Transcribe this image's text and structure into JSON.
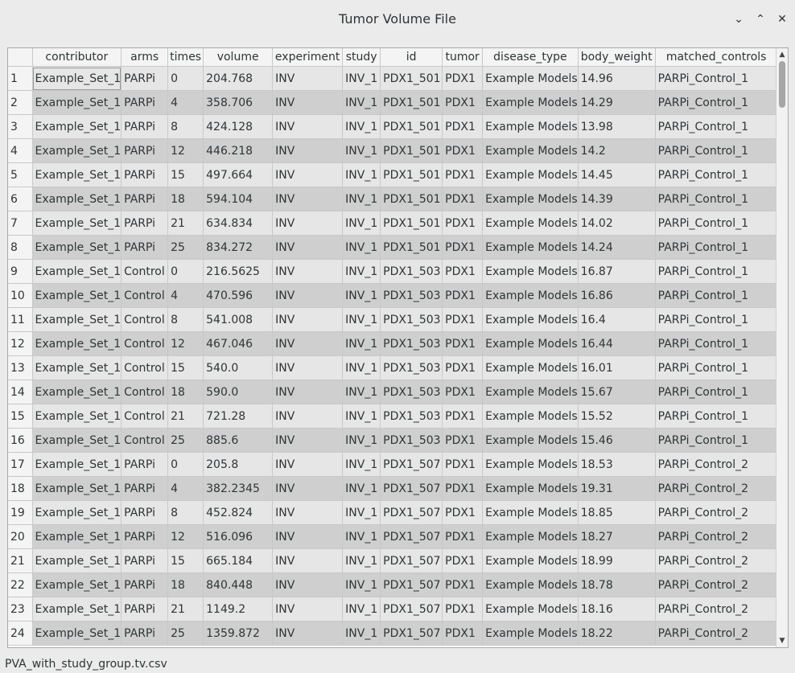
{
  "window": {
    "title": "Tumor Volume File",
    "buttons": {
      "minimize": "⌄",
      "maximize": "⌃",
      "close": "✕"
    }
  },
  "table": {
    "columns": [
      "",
      "contributor",
      "arms",
      "times",
      "volume",
      "experiment",
      "study",
      "id",
      "tumor",
      "disease_type",
      "body_weight",
      "matched_controls"
    ],
    "rows": [
      [
        "1",
        "Example_Set_1",
        "PARPi",
        "0",
        "204.768",
        "INV",
        "INV_1",
        "PDX1_501",
        "PDX1",
        "Example Models",
        "14.96",
        "PARPi_Control_1"
      ],
      [
        "2",
        "Example_Set_1",
        "PARPi",
        "4",
        "358.706",
        "INV",
        "INV_1",
        "PDX1_501",
        "PDX1",
        "Example Models",
        "14.29",
        "PARPi_Control_1"
      ],
      [
        "3",
        "Example_Set_1",
        "PARPi",
        "8",
        "424.128",
        "INV",
        "INV_1",
        "PDX1_501",
        "PDX1",
        "Example Models",
        "13.98",
        "PARPi_Control_1"
      ],
      [
        "4",
        "Example_Set_1",
        "PARPi",
        "12",
        "446.218",
        "INV",
        "INV_1",
        "PDX1_501",
        "PDX1",
        "Example Models",
        "14.2",
        "PARPi_Control_1"
      ],
      [
        "5",
        "Example_Set_1",
        "PARPi",
        "15",
        "497.664",
        "INV",
        "INV_1",
        "PDX1_501",
        "PDX1",
        "Example Models",
        "14.45",
        "PARPi_Control_1"
      ],
      [
        "6",
        "Example_Set_1",
        "PARPi",
        "18",
        "594.104",
        "INV",
        "INV_1",
        "PDX1_501",
        "PDX1",
        "Example Models",
        "14.39",
        "PARPi_Control_1"
      ],
      [
        "7",
        "Example_Set_1",
        "PARPi",
        "21",
        "634.834",
        "INV",
        "INV_1",
        "PDX1_501",
        "PDX1",
        "Example Models",
        "14.02",
        "PARPi_Control_1"
      ],
      [
        "8",
        "Example_Set_1",
        "PARPi",
        "25",
        "834.272",
        "INV",
        "INV_1",
        "PDX1_501",
        "PDX1",
        "Example Models",
        "14.24",
        "PARPi_Control_1"
      ],
      [
        "9",
        "Example_Set_1",
        "Control",
        "0",
        "216.5625",
        "INV",
        "INV_1",
        "PDX1_503",
        "PDX1",
        "Example Models",
        "16.87",
        "PARPi_Control_1"
      ],
      [
        "10",
        "Example_Set_1",
        "Control",
        "4",
        "470.596",
        "INV",
        "INV_1",
        "PDX1_503",
        "PDX1",
        "Example Models",
        "16.86",
        "PARPi_Control_1"
      ],
      [
        "11",
        "Example_Set_1",
        "Control",
        "8",
        "541.008",
        "INV",
        "INV_1",
        "PDX1_503",
        "PDX1",
        "Example Models",
        "16.4",
        "PARPi_Control_1"
      ],
      [
        "12",
        "Example_Set_1",
        "Control",
        "12",
        "467.046",
        "INV",
        "INV_1",
        "PDX1_503",
        "PDX1",
        "Example Models",
        "16.44",
        "PARPi_Control_1"
      ],
      [
        "13",
        "Example_Set_1",
        "Control",
        "15",
        "540.0",
        "INV",
        "INV_1",
        "PDX1_503",
        "PDX1",
        "Example Models",
        "16.01",
        "PARPi_Control_1"
      ],
      [
        "14",
        "Example_Set_1",
        "Control",
        "18",
        "590.0",
        "INV",
        "INV_1",
        "PDX1_503",
        "PDX1",
        "Example Models",
        "15.67",
        "PARPi_Control_1"
      ],
      [
        "15",
        "Example_Set_1",
        "Control",
        "21",
        "721.28",
        "INV",
        "INV_1",
        "PDX1_503",
        "PDX1",
        "Example Models",
        "15.52",
        "PARPi_Control_1"
      ],
      [
        "16",
        "Example_Set_1",
        "Control",
        "25",
        "885.6",
        "INV",
        "INV_1",
        "PDX1_503",
        "PDX1",
        "Example Models",
        "15.46",
        "PARPi_Control_1"
      ],
      [
        "17",
        "Example_Set_1",
        "PARPi",
        "0",
        "205.8",
        "INV",
        "INV_1",
        "PDX1_507",
        "PDX1",
        "Example Models",
        "18.53",
        "PARPi_Control_2"
      ],
      [
        "18",
        "Example_Set_1",
        "PARPi",
        "4",
        "382.2345",
        "INV",
        "INV_1",
        "PDX1_507",
        "PDX1",
        "Example Models",
        "19.31",
        "PARPi_Control_2"
      ],
      [
        "19",
        "Example_Set_1",
        "PARPi",
        "8",
        "452.824",
        "INV",
        "INV_1",
        "PDX1_507",
        "PDX1",
        "Example Models",
        "18.85",
        "PARPi_Control_2"
      ],
      [
        "20",
        "Example_Set_1",
        "PARPi",
        "12",
        "516.096",
        "INV",
        "INV_1",
        "PDX1_507",
        "PDX1",
        "Example Models",
        "18.27",
        "PARPi_Control_2"
      ],
      [
        "21",
        "Example_Set_1",
        "PARPi",
        "15",
        "665.184",
        "INV",
        "INV_1",
        "PDX1_507",
        "PDX1",
        "Example Models",
        "18.99",
        "PARPi_Control_2"
      ],
      [
        "22",
        "Example_Set_1",
        "PARPi",
        "18",
        "840.448",
        "INV",
        "INV_1",
        "PDX1_507",
        "PDX1",
        "Example Models",
        "18.78",
        "PARPi_Control_2"
      ],
      [
        "23",
        "Example_Set_1",
        "PARPi",
        "21",
        "1149.2",
        "INV",
        "INV_1",
        "PDX1_507",
        "PDX1",
        "Example Models",
        "18.16",
        "PARPi_Control_2"
      ],
      [
        "24",
        "Example_Set_1",
        "PARPi",
        "25",
        "1359.872",
        "INV",
        "INV_1",
        "PDX1_507",
        "PDX1",
        "Example Models",
        "18.22",
        "PARPi_Control_2"
      ]
    ]
  },
  "scrollbar": {
    "up_icon": "▲",
    "down_icon": "▼"
  },
  "status": {
    "filename": "PVA_with_study_group.tv.csv"
  }
}
